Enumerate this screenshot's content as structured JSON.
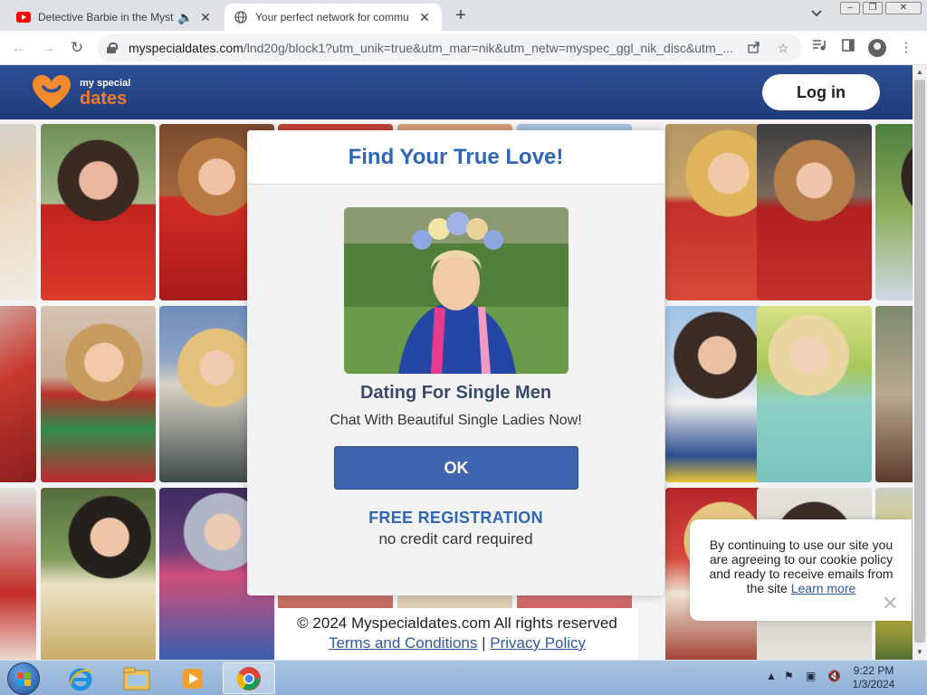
{
  "browser": {
    "tabs": [
      {
        "title": "Detective Barbie in the Myst",
        "icon": "youtube-icon",
        "audio_icon": "speaker-icon",
        "active": false
      },
      {
        "title": "Your perfect network for commu",
        "icon": "globe-icon",
        "active": true
      }
    ],
    "new_tab_label": "+",
    "tab_search_icon": "⌄",
    "window_controls": {
      "minimize": "▭",
      "restore": "❐",
      "close": "✕"
    },
    "url_host": "myspecialdates.com",
    "url_path": "/lnd20g/block1?utm_unik=true&utm_mar=nik&utm_netw=myspec_ggl_nik_disc&utm_...",
    "toolbar_icons": [
      "back-icon",
      "forward-icon",
      "reload-icon",
      "share-icon",
      "star-icon",
      "media-icon",
      "sidepanel-icon",
      "profile-icon",
      "menu-icon"
    ]
  },
  "site": {
    "logo_small": "my special",
    "logo_big": "dates",
    "login_label": "Log in",
    "brand_colors": {
      "header": "#2e4f96",
      "accent": "#f27a2a",
      "link": "#2f66b8"
    }
  },
  "modal": {
    "title": "Find Your True Love!",
    "heading": "Dating For Single Men",
    "subheading": "Chat With Beautiful Single Ladies Now!",
    "ok_label": "OK",
    "free_registration": "FREE REGISTRATION",
    "no_card": "no credit card required"
  },
  "footer": {
    "copyright": "© 2024 Myspecialdates.com All rights reserved",
    "terms": "Terms and Conditions",
    "separator": "|",
    "privacy": "Privacy Policy"
  },
  "cookie": {
    "text": "By continuing to use our site you are agreeing to our cookie policy and ready to receive emails from the site",
    "link": "Learn more",
    "close": "✕"
  },
  "taskbar": {
    "items": [
      "internet-explorer-icon",
      "file-explorer-icon",
      "media-player-icon",
      "chrome-icon"
    ],
    "time": "9:22 PM",
    "date": "1/3/2024"
  }
}
